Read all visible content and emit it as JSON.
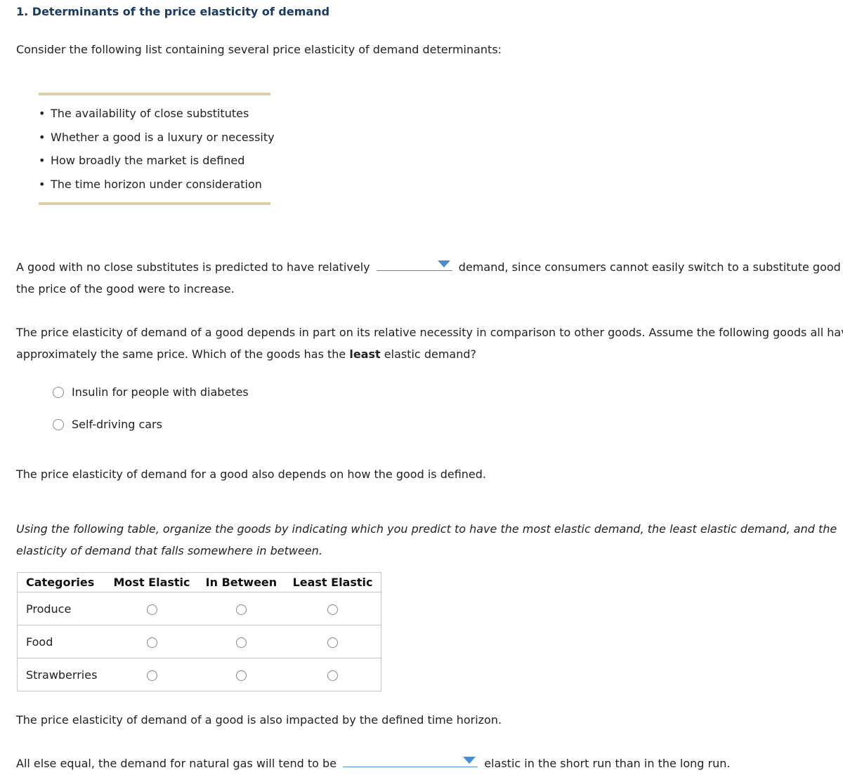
{
  "title": "1. Determinants of the price elasticity of demand",
  "intro": "Consider the following list containing several price elasticity of demand determinants:",
  "determinants": [
    "The availability of close substitutes",
    "Whether a good is a luxury or necessity",
    "How broadly the market is defined",
    "The time horizon under consideration"
  ],
  "q1": {
    "before": "A good with no close substitutes is predicted to have relatively",
    "dropdown_value": "",
    "after_line1": "demand, since consumers cannot easily switch to a substitute good if",
    "line2": "the price of the good were to increase."
  },
  "q2": {
    "line1": "The price elasticity of demand of a good depends in part on its relative necessity in comparison to other goods. Assume the following goods all have",
    "line2_before": "approximately the same price. Which of the goods has the",
    "line2_bold": "least",
    "line2_after": "elastic demand?",
    "options": [
      "Insulin for people with diabetes",
      "Self-driving cars"
    ]
  },
  "q3": {
    "statement": "The price elasticity of demand for a good also depends on how the good is defined.",
    "instruction_line1": "Using the following table, organize the goods by indicating which you predict to have the most elastic demand, the least elastic demand, and the",
    "instruction_line2": "elasticity of demand that falls somewhere in between.",
    "table": {
      "headers": [
        "Categories",
        "Most Elastic",
        "In Between",
        "Least Elastic"
      ],
      "rows": [
        "Produce",
        "Food",
        "Strawberries"
      ]
    }
  },
  "q4": {
    "statement": "The price elasticity of demand of a good is also impacted by the defined time horizon.",
    "before": "All else equal, the demand for natural gas will tend to be",
    "dropdown_value": "",
    "after": "elastic in the short run than in the long run."
  },
  "colors": {
    "title": "#1b3a63",
    "rule": "#ddd0a4",
    "dropdown": "#4a8ccf"
  }
}
